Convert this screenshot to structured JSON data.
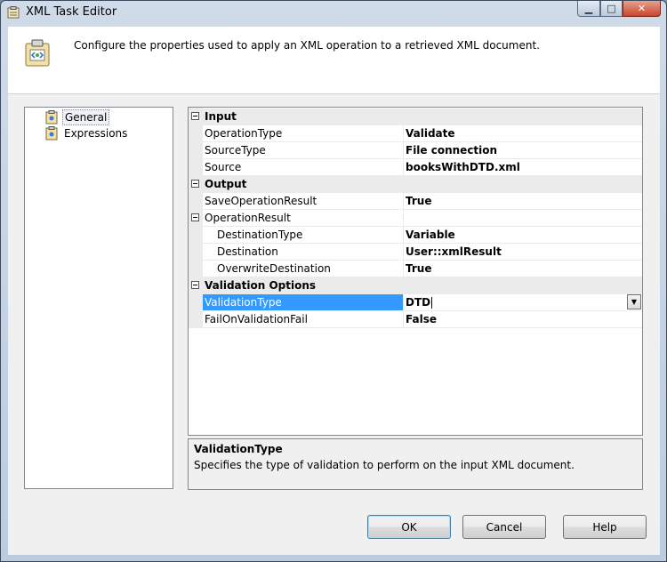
{
  "window": {
    "title": "XML Task Editor"
  },
  "header": {
    "description": "Configure the properties used to apply an XML operation to a retrieved XML document."
  },
  "nav": {
    "items": [
      {
        "label": "General"
      },
      {
        "label": "Expressions"
      }
    ]
  },
  "grid": {
    "categories": {
      "input": "Input",
      "output": "Output",
      "validation": "Validation Options"
    },
    "rows": {
      "operation_type": {
        "name": "OperationType",
        "value": "Validate"
      },
      "source_type": {
        "name": "SourceType",
        "value": "File connection"
      },
      "source": {
        "name": "Source",
        "value": "booksWithDTD.xml"
      },
      "save_operation_result": {
        "name": "SaveOperationResult",
        "value": "True"
      },
      "operation_result": {
        "name": "OperationResult",
        "value": ""
      },
      "destination_type": {
        "name": "DestinationType",
        "value": "Variable"
      },
      "destination": {
        "name": "Destination",
        "value": "User::xmlResult"
      },
      "overwrite_destination": {
        "name": "OverwriteDestination",
        "value": "True"
      },
      "validation_type": {
        "name": "ValidationType",
        "value": "DTD"
      },
      "fail_on_validation_fail": {
        "name": "FailOnValidationFail",
        "value": "False"
      }
    }
  },
  "description_panel": {
    "title": "ValidationType",
    "text": "Specifies the type of validation to perform on the input XML document."
  },
  "buttons": {
    "ok": "OK",
    "cancel": "Cancel",
    "help": "Help"
  }
}
